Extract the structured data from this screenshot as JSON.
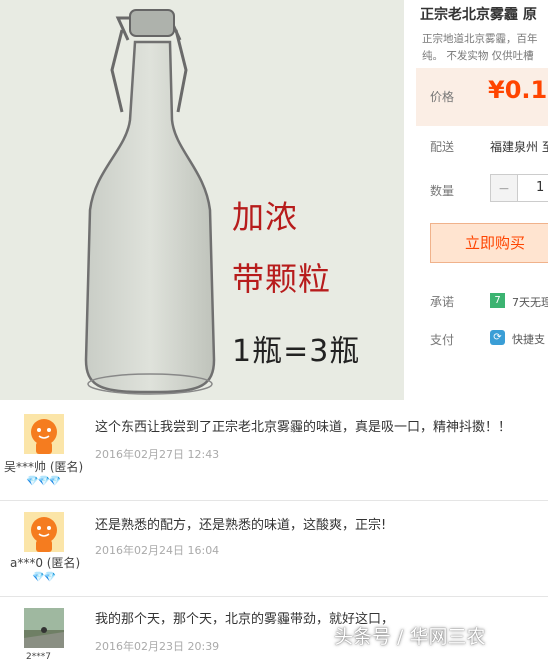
{
  "product": {
    "title": "正宗老北京雾霾 原",
    "description_line1": "正宗地道北京雾霾，百年",
    "description_line2": "纯。 不发实物 仅供吐槽",
    "image_texts": [
      "加浓",
      "带颗粒",
      "1瓶=3瓶"
    ],
    "price_label": "价格",
    "price_value": "¥0.1",
    "shipping_label": "配送",
    "shipping_value": "福建泉州 至",
    "quantity_label": "数量",
    "quantity_value": "1",
    "quantity_minus": "−",
    "buy_button": "立即购买",
    "promise_label": "承诺",
    "promise_icon": "7",
    "promise_value": "7天无理",
    "pay_label": "支付",
    "pay_value": "快捷支",
    "colors": {
      "accent": "#ff4400",
      "price_bg": "#fbeee5",
      "buy_bg": "#ffe4d0",
      "promise_icon": "#3cb371",
      "pay_icon": "#3a9ed6"
    }
  },
  "reviews": [
    {
      "user": "吴***帅 (匿名)",
      "text": "这个东西让我尝到了正宗老北京雾霾的味道，真是吸一口，精神抖擞！！",
      "date": "2016年02月27日  12:43",
      "hearts": "💎💎💎",
      "avatar": "orange-avatar-icon"
    },
    {
      "user": "a***0 (匿名)",
      "text": "还是熟悉的配方，还是熟悉的味道，这酸爽，正宗!",
      "date": "2016年02月24日  16:04",
      "hearts": "💎💎",
      "avatar": "orange-avatar-icon"
    },
    {
      "user": "2***7",
      "text": "我的那个天，那个天，北京的雾霾带劲，就好这口，",
      "date": "2016年02月23日  20:39",
      "hearts": "",
      "avatar": "photo-avatar-icon"
    }
  ],
  "watermark": "头条号 / 华网三农"
}
